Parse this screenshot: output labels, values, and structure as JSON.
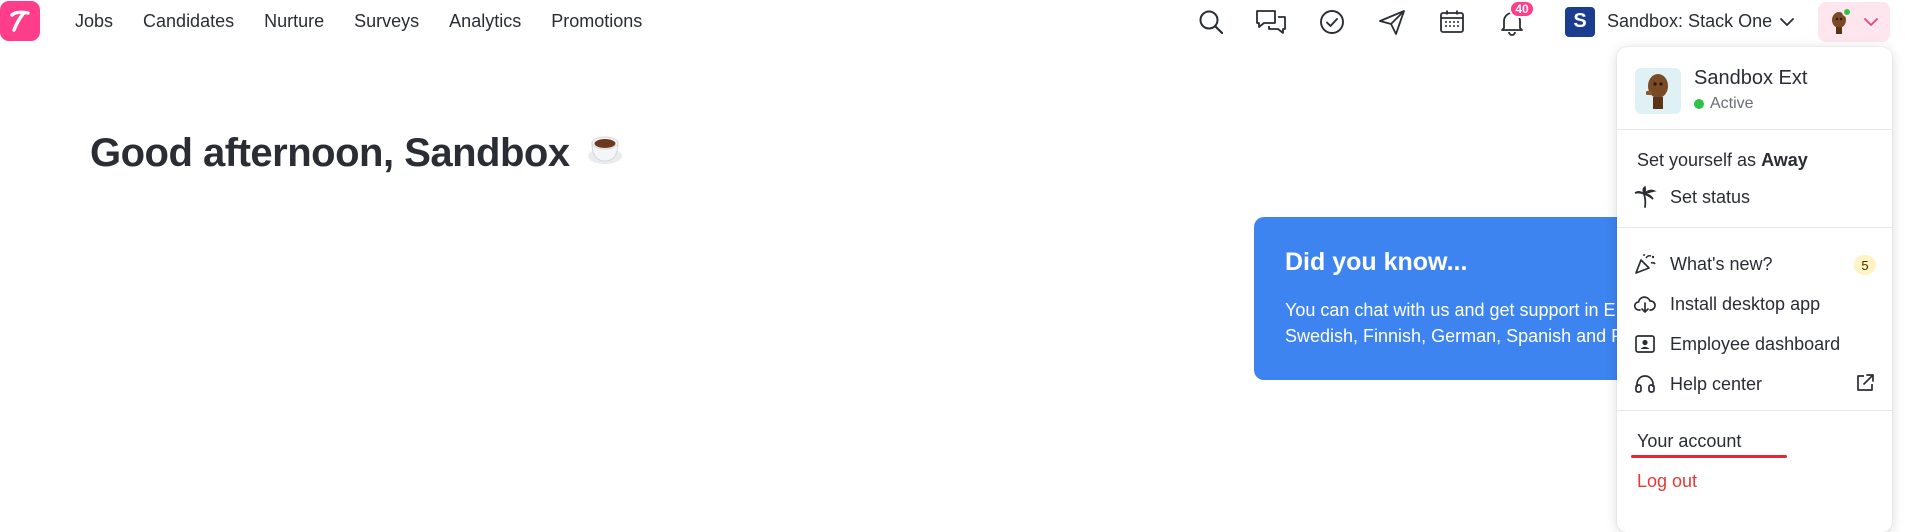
{
  "nav": {
    "items": [
      "Jobs",
      "Candidates",
      "Nurture",
      "Surveys",
      "Analytics",
      "Promotions"
    ]
  },
  "topbar_icons": [
    "search-icon",
    "chat-icon",
    "check-circle-icon",
    "send-icon",
    "calendar-icon",
    "bell-icon"
  ],
  "notifications": {
    "count": "40"
  },
  "workspace": {
    "initial": "S",
    "name": "Sandbox: Stack One"
  },
  "greeting": {
    "text": "Good afternoon, Sandbox"
  },
  "tip": {
    "title": "Did you know...",
    "line1": "You can chat with us and get support in E",
    "line2": "Swedish, Finnish, German, Spanish and P"
  },
  "user_menu": {
    "name": "Sandbox Ext",
    "status": "Active",
    "set_away_prefix": "Set yourself as",
    "set_away_bold": "Away",
    "set_status": "Set status",
    "whats_new": "What's new?",
    "whats_new_count": "5",
    "install_app": "Install desktop app",
    "employee_dashboard": "Employee dashboard",
    "help_center": "Help center",
    "your_account": "Your account",
    "log_out": "Log out"
  },
  "colors": {
    "brand": "#ff3d8b",
    "workspace": "#1a3d8f",
    "tip_card": "#3d84f0",
    "online": "#2ec24b",
    "logout": "#e53935",
    "highlight_underline": "#e8272e"
  }
}
